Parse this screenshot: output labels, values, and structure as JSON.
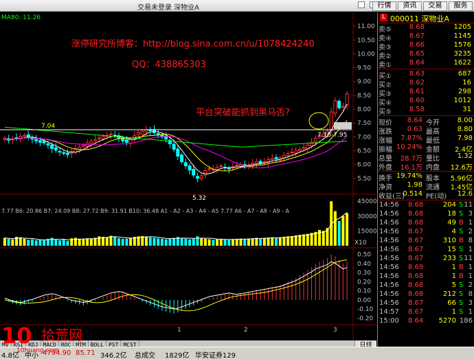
{
  "window": {
    "title": "交易未登录  深物业A"
  },
  "top_buttons": [
    "行情",
    "资讯",
    "交易",
    "服务"
  ],
  "stock": {
    "code": "000011",
    "name": "深物业A"
  },
  "chart_text": {
    "ma_label": "MA80: 11.26",
    "blog": "涨停研究所博客：http://blog.sina.com.cn/u/1078424240",
    "qq": "QQ：438865303",
    "question": "平台突破能抓到黑马否?",
    "low_label": "5.32",
    "left_label": "7.04",
    "range_label": "7.18-7.95",
    "mid_indicator": "7.77  B6: 20.86  B7: 24.09  B8: 27.72  B9: 31.91  B10: 36.48  A1 - A2 - A3 - A4 - A5  7.77  A6 - A7 - A8 - A9 - A",
    "x10": "X10",
    "macd_ticks": [
      "1",
      "2",
      "3"
    ],
    "day_tab": "日线"
  },
  "price_axis": [
    "11.00",
    "10.50",
    "10.00",
    "9.50",
    "9.00",
    "8.50",
    "8.00",
    "7.50",
    "7.00",
    "6.50",
    "6.00",
    "5.50"
  ],
  "volume_axis": [
    "45000",
    "30000",
    "15000"
  ],
  "macd_axis": [
    "0.50",
    "0.40",
    "0.30",
    "0.20",
    "0.10",
    "0.00",
    "-0.10",
    "-0.20"
  ],
  "chart_data": {
    "type": "candlestick",
    "ylim": [
      5.0,
      11.3
    ],
    "close": [
      6.95,
      6.88,
      6.92,
      6.96,
      7.02,
      7.05,
      7.0,
      6.92,
      6.85,
      6.8,
      6.78,
      6.7,
      6.58,
      6.52,
      6.45,
      6.4,
      6.36,
      6.48,
      6.55,
      6.62,
      6.7,
      6.78,
      6.84,
      6.9,
      6.96,
      7.02,
      7.05,
      7.1,
      7.05,
      6.95,
      6.85,
      6.8,
      6.9,
      7.05,
      7.15,
      7.2,
      7.25,
      7.22,
      7.15,
      7.08,
      7.0,
      6.92,
      6.75,
      6.55,
      6.3,
      6.1,
      5.95,
      5.8,
      5.62,
      5.5,
      5.6,
      5.78,
      5.85,
      5.82,
      5.9,
      5.95,
      5.88,
      5.85,
      5.92,
      5.98,
      6.0,
      5.95,
      5.98,
      6.05,
      6.1,
      6.05,
      6.1,
      6.18,
      6.22,
      6.2,
      6.25,
      6.32,
      6.4,
      6.45,
      6.5,
      6.55,
      6.62,
      6.7,
      6.8,
      6.95,
      7.05,
      7.1,
      7.2,
      7.9,
      8.3,
      8.05,
      8.1,
      8.55
    ],
    "volume": [
      8000,
      7000,
      6500,
      9000,
      8500,
      7000,
      6000,
      6500,
      5500,
      6000,
      5500,
      7000,
      8000,
      6000,
      5500,
      6500,
      5000,
      7500,
      8000,
      7000,
      6500,
      7000,
      7200,
      8000,
      9500,
      9000,
      8500,
      10000,
      9000,
      7500,
      7000,
      7200,
      8000,
      9000,
      9500,
      9800,
      9000,
      8500,
      8000,
      7500,
      7000,
      6500,
      7000,
      8000,
      9000,
      7500,
      7000,
      6500,
      7200,
      9500,
      8000,
      7000,
      6500,
      6000,
      6500,
      7000,
      6200,
      6000,
      6500,
      7000,
      7200,
      6800,
      7000,
      7500,
      8000,
      7500,
      7800,
      8200,
      8500,
      8000,
      8500,
      9000,
      9500,
      9800,
      10500,
      11000,
      11500,
      12000,
      13000,
      14000,
      16000,
      15000,
      18000,
      45000,
      35000,
      25000,
      30000,
      33000
    ],
    "ma_short": "computed",
    "macd": [
      0.0,
      -0.02,
      -0.04,
      -0.05,
      -0.06,
      -0.05,
      -0.03,
      -0.02,
      0.0,
      0.02,
      0.04,
      0.05,
      0.06,
      0.05,
      0.03,
      0.01,
      -0.01,
      -0.03,
      -0.04,
      -0.05,
      -0.06,
      -0.05,
      -0.03,
      -0.01,
      0.01,
      0.03,
      0.05,
      0.07,
      0.08,
      0.09,
      0.08,
      0.06,
      0.04,
      0.02,
      0.0,
      -0.02,
      -0.04,
      -0.06,
      -0.08,
      -0.1,
      -0.12,
      -0.13,
      -0.14,
      -0.15,
      -0.14,
      -0.12,
      -0.1,
      -0.08,
      -0.06,
      -0.04,
      -0.02,
      0.0,
      0.02,
      0.03,
      0.04,
      0.05,
      0.06,
      0.07,
      0.06,
      0.05,
      0.06,
      0.07,
      0.08,
      0.09,
      0.1,
      0.11,
      0.12,
      0.13,
      0.14,
      0.15,
      0.16,
      0.18,
      0.2,
      0.22,
      0.24,
      0.27,
      0.3,
      0.33,
      0.36,
      0.4,
      0.42,
      0.44,
      0.46,
      0.5,
      0.48,
      0.44,
      0.4,
      0.42
    ]
  },
  "orderbook": {
    "sell": [
      {
        "label": "卖⑤",
        "price": "8.68",
        "vol": "1205"
      },
      {
        "label": "卖④",
        "price": "8.67",
        "vol": "1145"
      },
      {
        "label": "卖③",
        "price": "8.66",
        "vol": "1576"
      },
      {
        "label": "卖②",
        "price": "8.65",
        "vol": "3235"
      },
      {
        "label": "卖①",
        "price": "8.64",
        "vol": "1622"
      }
    ],
    "buy": [
      {
        "label": "买①",
        "price": "8.63",
        "vol": "687"
      },
      {
        "label": "买②",
        "price": "8.62",
        "vol": "16"
      },
      {
        "label": "买③",
        "price": "8.61",
        "vol": "298"
      },
      {
        "label": "买④",
        "price": "8.60",
        "vol": "1012"
      },
      {
        "label": "买⑤",
        "price": "8.58",
        "vol": "31"
      }
    ]
  },
  "stats": [
    {
      "l": "现价",
      "lv": "8.64",
      "r": "今开",
      "rv": "8.00"
    },
    {
      "l": "涨跌",
      "lv": "0.63",
      "r": "最高",
      "rv": "8.80"
    },
    {
      "l": "涨幅",
      "lv": "7.87%",
      "r": "最低",
      "rv": "7.98"
    },
    {
      "l": "振幅",
      "lv": "10.24%",
      "r": "金额",
      "rv": "2.4亿"
    },
    {
      "l": "总量",
      "lv": "28.7万",
      "r": "量比",
      "rv": "1.32"
    },
    {
      "l": "外盘",
      "lv": "16.1万",
      "r": "内盘",
      "rv": "12.6万"
    }
  ],
  "stats2": [
    {
      "l": "换手",
      "lv": "19.74%",
      "r": "股本",
      "rv": "5.96亿"
    },
    {
      "l": "净资",
      "lv": "1.98",
      "r": "流通",
      "rv": "1.45亿"
    },
    {
      "l": "收益(三)",
      "lv": "0.514",
      "r": "PE(动)",
      "rv": "12.6"
    }
  ],
  "ticks": [
    {
      "time": "14:56",
      "price": "8.68",
      "vol": "204",
      "side": "S",
      "n": "11"
    },
    {
      "time": "14:56",
      "price": "8.68",
      "vol": "18",
      "side": "S",
      "n": "3"
    },
    {
      "time": "14:56",
      "price": "8.68",
      "vol": "49",
      "side": "B",
      "n": "1"
    },
    {
      "time": "14:56",
      "price": "8.67",
      "vol": "4",
      "side": "S",
      "n": "2"
    },
    {
      "time": "14:56",
      "price": "8.67",
      "vol": "310",
      "side": "B",
      "n": "8"
    },
    {
      "time": "14:56",
      "price": "8.67",
      "vol": "15",
      "side": "S",
      "n": "1"
    },
    {
      "time": "14:56",
      "price": "8.67",
      "vol": "233",
      "side": "S",
      "n": "11"
    },
    {
      "time": "14:56",
      "price": "8.69",
      "vol": "1",
      "side": "B",
      "n": "1"
    },
    {
      "time": "14:56",
      "price": "8.68",
      "vol": "1",
      "side": "B",
      "n": "1"
    },
    {
      "time": "14:56",
      "price": "8.68",
      "vol": "5",
      "side": "S",
      "n": "2"
    },
    {
      "time": "14:56",
      "price": "8.68",
      "vol": "212",
      "side": "S",
      "n": "8"
    },
    {
      "time": "14:56",
      "price": "8.67",
      "vol": "66",
      "side": "S",
      "n": "3"
    },
    {
      "time": "14:57",
      "price": "8.67",
      "vol": "1",
      "side": "S",
      "n": "1"
    },
    {
      "time": "15:00",
      "price": "8.64",
      "vol": "5270",
      "side": "",
      "n": "186"
    }
  ],
  "tabs": [
    "MV",
    "RSI",
    "KDJ",
    "MACD",
    "ROC",
    "MTM",
    "BOLL",
    "PST",
    "MCST"
  ],
  "statusbar": {
    "a": "4.8亿",
    "b": "中小",
    "c": "4794.90",
    "d": "85.71",
    "e": "346.2亿",
    "f": "总成交",
    "g": "1829亿",
    "h": "华安证券129"
  },
  "watermark": {
    "big": "10",
    "cn": "拾荒网",
    "url": "10huang.com"
  },
  "colors": {
    "up": "#ff3030",
    "down": "#00ffff",
    "ma5": "#ffffff",
    "ma10": "#ffff00",
    "ma20": "#ff00ff",
    "ma60": "#00ff00",
    "grid": "#800000"
  }
}
